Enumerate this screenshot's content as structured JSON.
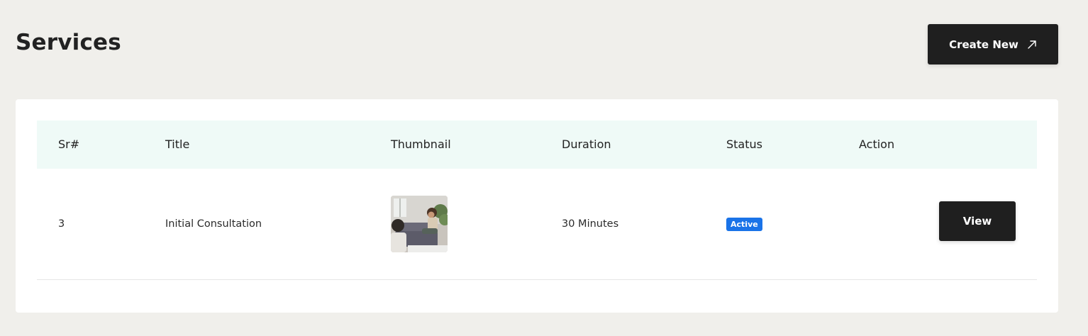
{
  "header": {
    "title": "Services",
    "create_button_label": "Create New"
  },
  "table": {
    "columns": [
      "Sr#",
      "Title",
      "Thumbnail",
      "Duration",
      "Status",
      "Action"
    ],
    "rows": [
      {
        "sr": "3",
        "title": "Initial Consultation",
        "thumbnail_icon": "consultation-photo",
        "duration": "30 Minutes",
        "status": "Active",
        "action_label": "View"
      }
    ]
  },
  "colors": {
    "background": "#f0efeb",
    "primary_button": "#1f1f1f",
    "table_header_bg": "#effaf7",
    "status_active": "#1a73e8"
  }
}
